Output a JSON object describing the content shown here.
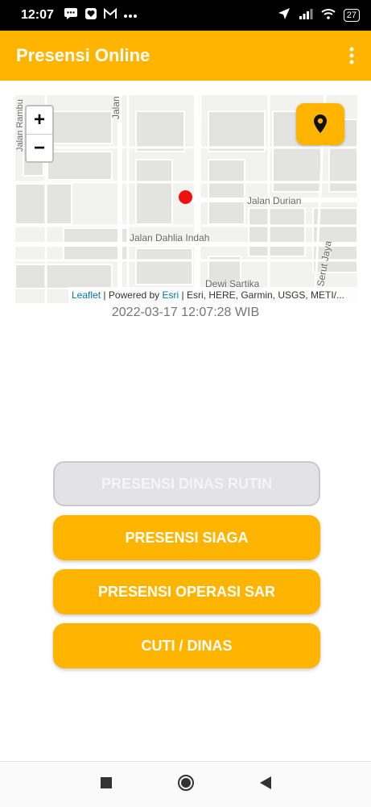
{
  "status_bar": {
    "time": "12:07",
    "battery": "27"
  },
  "app_bar": {
    "title": "Presensi Online"
  },
  "map": {
    "zoom_in": "+",
    "zoom_out": "−",
    "labels": {
      "jalan_vertical": "Jalan",
      "jalan_durian": "Jalan Durian",
      "jalan_dahlia": "Jalan Dahlia Indah",
      "dewi_sartika": "Dewi Sartika",
      "serut_jaya": "Serut Jaya",
      "left_edge": "Jalan Rambu"
    },
    "attribution": {
      "leaflet": "Leaflet",
      "powered": " | Powered by ",
      "esri": "Esri",
      "sources": " | Esri, HERE, Garmin, USGS, METI/..."
    }
  },
  "timestamp": "2022-03-17 12:07:28 WIB",
  "buttons": {
    "dinas_rutin": "PRESENSI DINAS RUTIN",
    "siaga": "PRESENSI SIAGA",
    "operasi_sar": "PRESENSI OPERASI SAR",
    "cuti_dinas": "CUTI / DINAS"
  },
  "colors": {
    "accent": "#FFB400",
    "marker": "#F01010"
  }
}
